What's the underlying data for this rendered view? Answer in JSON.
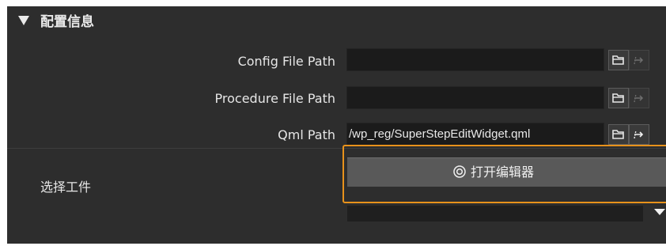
{
  "section": {
    "title": "配置信息",
    "collapse_icon": "triangle-down-icon"
  },
  "rows": [
    {
      "label": "Config File Path",
      "value": "",
      "browse_icon": "folder-icon",
      "action_icon": "link-icon",
      "action_enabled": false
    },
    {
      "label": "Procedure File Path",
      "value": "",
      "browse_icon": "folder-icon",
      "action_icon": "link-icon",
      "action_enabled": false
    },
    {
      "label": "Qml Path",
      "value": "/wp_reg/SuperStepEditWidget.qml",
      "browse_icon": "folder-icon",
      "action_icon": "link-icon",
      "action_enabled": true
    }
  ],
  "workpiece": {
    "label": "选择工件",
    "open_editor_label": "打开编辑器",
    "open_editor_icon": "target-icon",
    "selected_value": ""
  },
  "colors": {
    "panel_bg": "#2d2d2d",
    "input_bg": "#1b1b1b",
    "button_bg": "#595959",
    "highlight": "#e8921b",
    "text": "#e6e6e6"
  }
}
